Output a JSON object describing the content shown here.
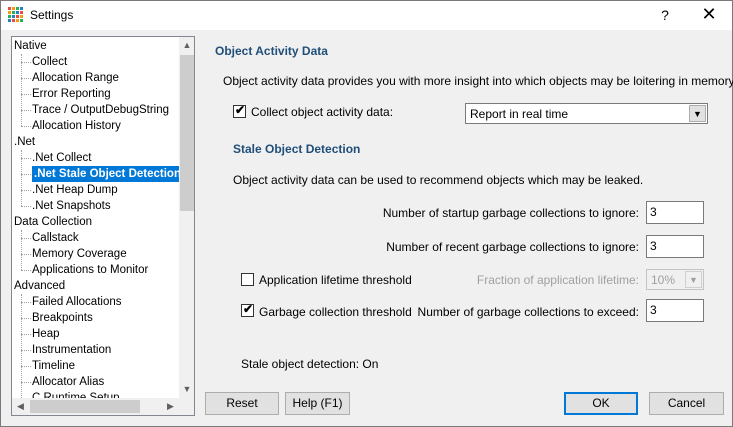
{
  "window": {
    "title": "Settings",
    "help_glyph": "?",
    "close_glyph": "✕",
    "icon": "settings-grid-icon"
  },
  "tree": {
    "items": [
      {
        "label": "Native",
        "level": 0
      },
      {
        "label": "Collect",
        "level": 1
      },
      {
        "label": "Allocation Range",
        "level": 1
      },
      {
        "label": "Error Reporting",
        "level": 1
      },
      {
        "label": "Trace / OutputDebugString",
        "level": 1
      },
      {
        "label": "Allocation History",
        "level": 1
      },
      {
        "label": ".Net",
        "level": 0
      },
      {
        "label": ".Net Collect",
        "level": 1
      },
      {
        "label": ".Net Stale Object Detection",
        "level": 1,
        "selected": true
      },
      {
        "label": ".Net Heap Dump",
        "level": 1
      },
      {
        "label": ".Net Snapshots",
        "level": 1
      },
      {
        "label": "Data Collection",
        "level": 0
      },
      {
        "label": "Callstack",
        "level": 1
      },
      {
        "label": "Memory Coverage",
        "level": 1
      },
      {
        "label": "Applications to Monitor",
        "level": 1
      },
      {
        "label": "Advanced",
        "level": 0
      },
      {
        "label": "Failed Allocations",
        "level": 1
      },
      {
        "label": "Breakpoints",
        "level": 1
      },
      {
        "label": "Heap",
        "level": 1
      },
      {
        "label": "Instrumentation",
        "level": 1
      },
      {
        "label": "Timeline",
        "level": 1
      },
      {
        "label": "Allocator Alias",
        "level": 1
      },
      {
        "label": "C Runtime Setup",
        "level": 1
      }
    ],
    "scroll_up": "▲",
    "scroll_down": "▼",
    "scroll_left": "◀",
    "scroll_right": "▶"
  },
  "panel": {
    "section_title": "Object Activity Data",
    "section_desc": "Object activity data provides you with more insight into which objects may be loitering in memory.",
    "collect_checkbox": {
      "label": "Collect object activity data:",
      "checked": true
    },
    "collect_mode": {
      "value": "Report in real time"
    },
    "stale_title": "Stale Object Detection",
    "stale_desc": "Object activity data can be used to recommend objects which may be leaked.",
    "startup_label": "Number of startup garbage collections to ignore:",
    "startup_value": "3",
    "recent_label": "Number of recent garbage collections to ignore:",
    "recent_value": "3",
    "lifetime_checkbox": {
      "label": "Application lifetime threshold",
      "checked": false
    },
    "fraction_label": "Fraction of application lifetime:",
    "fraction_value": "10%",
    "gc_checkbox": {
      "label": "Garbage collection threshold",
      "checked": true
    },
    "exceed_label": "Number of garbage collections to exceed:",
    "exceed_value": "3",
    "status": "Stale object detection: On",
    "check_glyph": "✔",
    "dropdown_glyph": "▼"
  },
  "buttons": {
    "reset": "Reset",
    "help": "Help (F1)",
    "ok": "OK",
    "cancel": "Cancel"
  },
  "colors": {
    "accent": "#0078d7",
    "heading": "#1f4e79"
  }
}
